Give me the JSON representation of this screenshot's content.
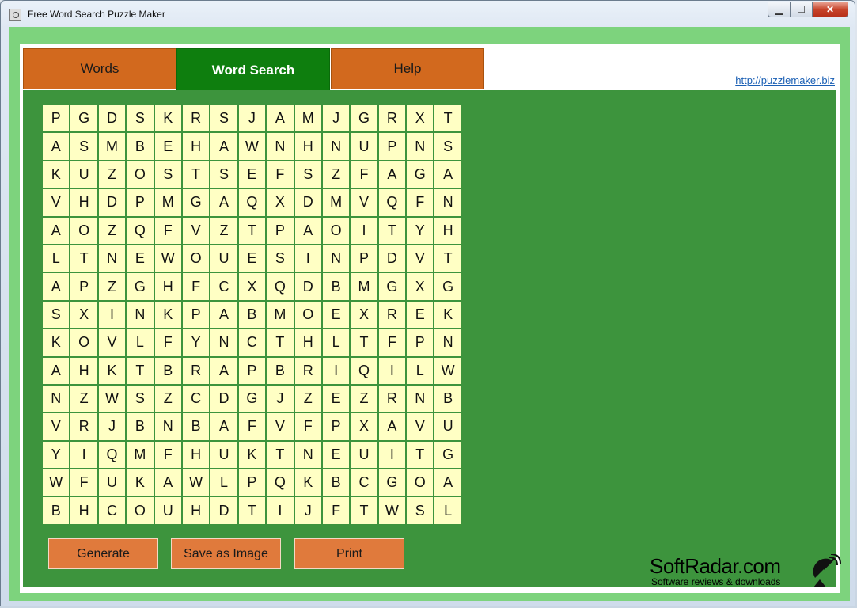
{
  "window": {
    "title": "Free Word Search Puzzle Maker"
  },
  "tabs": [
    {
      "label": "Words"
    },
    {
      "label": "Word Search"
    },
    {
      "label": "Help"
    }
  ],
  "link": "http://puzzlemaker.biz",
  "grid": [
    [
      "P",
      "G",
      "D",
      "S",
      "K",
      "R",
      "S",
      "J",
      "A",
      "M",
      "J",
      "G",
      "R",
      "X",
      "T"
    ],
    [
      "A",
      "S",
      "M",
      "B",
      "E",
      "H",
      "A",
      "W",
      "N",
      "H",
      "N",
      "U",
      "P",
      "N",
      "S"
    ],
    [
      "K",
      "U",
      "Z",
      "O",
      "S",
      "T",
      "S",
      "E",
      "F",
      "S",
      "Z",
      "F",
      "A",
      "G",
      "A"
    ],
    [
      "V",
      "H",
      "D",
      "P",
      "M",
      "G",
      "A",
      "Q",
      "X",
      "D",
      "M",
      "V",
      "Q",
      "F",
      "N"
    ],
    [
      "A",
      "O",
      "Z",
      "Q",
      "F",
      "V",
      "Z",
      "T",
      "P",
      "A",
      "O",
      "I",
      "T",
      "Y",
      "H"
    ],
    [
      "L",
      "T",
      "N",
      "E",
      "W",
      "O",
      "U",
      "E",
      "S",
      "I",
      "N",
      "P",
      "D",
      "V",
      "T"
    ],
    [
      "A",
      "P",
      "Z",
      "G",
      "H",
      "F",
      "C",
      "X",
      "Q",
      "D",
      "B",
      "M",
      "G",
      "X",
      "G"
    ],
    [
      "S",
      "X",
      "I",
      "N",
      "K",
      "P",
      "A",
      "B",
      "M",
      "O",
      "E",
      "X",
      "R",
      "E",
      "K"
    ],
    [
      "K",
      "O",
      "V",
      "L",
      "F",
      "Y",
      "N",
      "C",
      "T",
      "H",
      "L",
      "T",
      "F",
      "P",
      "N"
    ],
    [
      "A",
      "H",
      "K",
      "T",
      "B",
      "R",
      "A",
      "P",
      "B",
      "R",
      "I",
      "Q",
      "I",
      "L",
      "W"
    ],
    [
      "N",
      "Z",
      "W",
      "S",
      "Z",
      "C",
      "D",
      "G",
      "J",
      "Z",
      "E",
      "Z",
      "R",
      "N",
      "B"
    ],
    [
      "V",
      "R",
      "J",
      "B",
      "N",
      "B",
      "A",
      "F",
      "V",
      "F",
      "P",
      "X",
      "A",
      "V",
      "U"
    ],
    [
      "Y",
      "I",
      "Q",
      "M",
      "F",
      "H",
      "U",
      "K",
      "T",
      "N",
      "E",
      "U",
      "I",
      "T",
      "G"
    ],
    [
      "W",
      "F",
      "U",
      "K",
      "A",
      "W",
      "L",
      "P",
      "Q",
      "K",
      "B",
      "C",
      "G",
      "O",
      "A"
    ],
    [
      "B",
      "H",
      "C",
      "O",
      "U",
      "H",
      "D",
      "T",
      "I",
      "J",
      "F",
      "T",
      "W",
      "S",
      "L"
    ]
  ],
  "buttons": {
    "generate": "Generate",
    "save_image": "Save as Image",
    "print": "Print"
  },
  "watermark": {
    "name": "SoftRadar.com",
    "tagline": "Software reviews & downloads"
  },
  "colors": {
    "tab_inactive": "#d2691e",
    "tab_active": "#0e7e0e",
    "puzzle_bg": "#3d943d",
    "cell_bg": "#ffffc4",
    "button_bg": "#e07a3c"
  }
}
